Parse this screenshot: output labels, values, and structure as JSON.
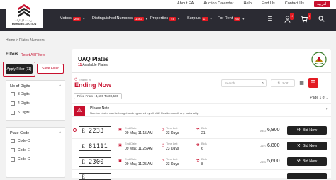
{
  "top_links": [
    "About EA",
    "Auction Calendar",
    "Help",
    "Find Us",
    "Contact Us"
  ],
  "language": "العربية",
  "logo": {
    "line1": "مزادات الإمارات",
    "line2": "EMIRATES AUCTION"
  },
  "nav": [
    {
      "label": "Motors",
      "badge": "265"
    },
    {
      "label": "Distinguished Numbers",
      "badge": "1463"
    },
    {
      "label": "Properties",
      "badge": "49"
    },
    {
      "label": "Surplus",
      "badge": "17"
    },
    {
      "label": "For Rent",
      "badge": "60"
    }
  ],
  "nav_icons": {
    "menu": "☰",
    "profile_badge": "19",
    "cart": "🛒",
    "cart_badge": "1"
  },
  "breadcrumb": "Home  >  Plates Numbers",
  "filters": {
    "title": "Filters",
    "reset": "Reset All Filters",
    "apply": "Apply Filter (11)",
    "save": "Save Filter",
    "digits": {
      "title": "No of Digits",
      "options": [
        "3 Digits",
        "4 Digits",
        "5 Digits"
      ]
    },
    "plate_code": {
      "title": "Plate Code",
      "options": [
        "Code-C",
        "Code-E",
        "Code-G"
      ]
    }
  },
  "category": {
    "title": "UAQ Plates",
    "count": "11",
    "available": "Available Plates"
  },
  "ending": {
    "label": "Ending In",
    "title": "Ending Now"
  },
  "search": {
    "placeholder": "Search ..."
  },
  "sort_label": "Sort",
  "price_chip": "Price From : 4,600 To 39,580",
  "page_of": "Page 1 of 1",
  "note": {
    "title": "Please Note",
    "text": "Number plates can be bought and registered by all UAE Residents with any nationality."
  },
  "row_labels": {
    "end_date": "End Date",
    "time_left": "Time Left",
    "bids": "Bids",
    "aed": "AED",
    "bid_now": "Bid Now"
  },
  "rows": [
    {
      "letter": "E",
      "number": "2233",
      "end_date": "09 May, 11:15 AM",
      "time_left": "23 Days",
      "bids": "21",
      "price": "6,800"
    },
    {
      "letter": "E",
      "number": "81111",
      "end_date": "09 May, 11:25 AM",
      "time_left": "23 Days",
      "bids": "6",
      "price": "6,800"
    },
    {
      "letter": "E",
      "number": "2300",
      "end_date": "09 May, 11:25 AM",
      "time_left": "23 Days",
      "bids": "8",
      "price": "5,600"
    },
    {
      "letter": "E",
      "number": "",
      "end_date": "",
      "time_left": "",
      "bids": "",
      "price": ""
    }
  ],
  "colors": {
    "brand_red": "#c8102e",
    "nav_bg": "#2b2b33",
    "bid_button": "#222222"
  }
}
